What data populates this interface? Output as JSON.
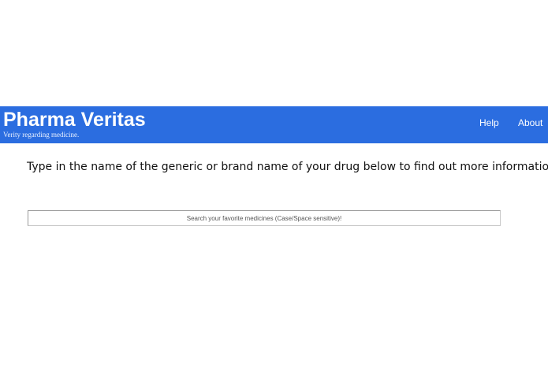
{
  "header": {
    "title": "Pharma Veritas",
    "tagline": "Verity regarding medicine.",
    "nav": {
      "help_label": "Help",
      "about_label": "About"
    },
    "background_color": "#2b6de0"
  },
  "main": {
    "intro": "Type in the name of the generic or brand name of your drug below to find out more information.",
    "search": {
      "value": "",
      "placeholder": "Search your favorite medicines (Case/Space sensitive)!"
    }
  }
}
